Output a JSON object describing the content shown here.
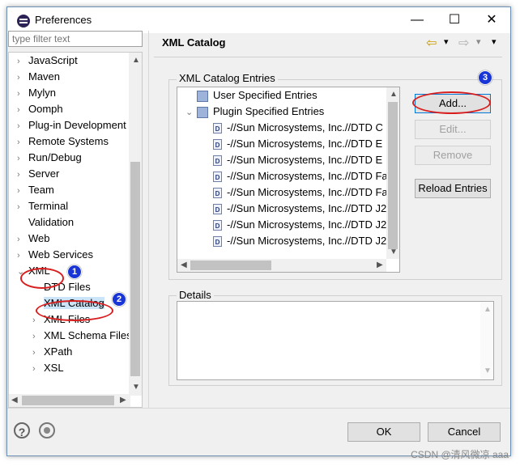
{
  "window": {
    "title": "Preferences",
    "min": "—",
    "max": "☐",
    "close": "✕"
  },
  "filter": {
    "placeholder": "type filter text"
  },
  "tree": {
    "items": [
      {
        "label": "JavaScript",
        "chevron": "›"
      },
      {
        "label": "Maven",
        "chevron": "›"
      },
      {
        "label": "Mylyn",
        "chevron": "›"
      },
      {
        "label": "Oomph",
        "chevron": "›"
      },
      {
        "label": "Plug-in Development",
        "chevron": "›"
      },
      {
        "label": "Remote Systems",
        "chevron": "›"
      },
      {
        "label": "Run/Debug",
        "chevron": "›"
      },
      {
        "label": "Server",
        "chevron": "›"
      },
      {
        "label": "Team",
        "chevron": "›"
      },
      {
        "label": "Terminal",
        "chevron": "›"
      },
      {
        "label": "Validation",
        "chevron": ""
      },
      {
        "label": "Web",
        "chevron": "›"
      },
      {
        "label": "Web Services",
        "chevron": "›"
      },
      {
        "label": "XML",
        "chevron": "⌄"
      },
      {
        "label": "DTD Files",
        "chevron": ""
      },
      {
        "label": "XML Catalog",
        "chevron": ""
      },
      {
        "label": "XML Files",
        "chevron": "›"
      },
      {
        "label": "XML Schema Files",
        "chevron": "›"
      },
      {
        "label": "XPath",
        "chevron": "›"
      },
      {
        "label": "XSL",
        "chevron": "›"
      }
    ]
  },
  "page": {
    "title": "XML Catalog"
  },
  "nav": {
    "back": "⇦",
    "fwd": "⇨",
    "dd": "▾",
    "menu": "▾"
  },
  "entries": {
    "group_label": "XML Catalog Entries",
    "rows": [
      {
        "label": "User Specified Entries",
        "chevron": ""
      },
      {
        "label": "Plugin Specified Entries",
        "chevron": "⌄"
      },
      {
        "label": "-//Sun Microsystems, Inc.//DTD C"
      },
      {
        "label": "-//Sun Microsystems, Inc.//DTD E"
      },
      {
        "label": "-//Sun Microsystems, Inc.//DTD E"
      },
      {
        "label": "-//Sun Microsystems, Inc.//DTD Fa"
      },
      {
        "label": "-//Sun Microsystems, Inc.//DTD Fa"
      },
      {
        "label": "-//Sun Microsystems, Inc.//DTD J2"
      },
      {
        "label": "-//Sun Microsystems, Inc.//DTD J2"
      },
      {
        "label": "-//Sun Microsystems, Inc.//DTD J2"
      }
    ],
    "file_glyph": "D"
  },
  "buttons": {
    "add": "Add...",
    "edit": "Edit...",
    "remove": "Remove",
    "reload": "Reload Entries"
  },
  "details": {
    "label": "Details"
  },
  "footer": {
    "ok": "OK",
    "cancel": "Cancel",
    "help": "?"
  },
  "badges": {
    "b1": "1",
    "b2": "2",
    "b3": "3"
  },
  "watermark": "CSDN @清风微凉 aaa",
  "colors": {
    "badge": "#1a35d6",
    "ring": "#d81e1e"
  }
}
